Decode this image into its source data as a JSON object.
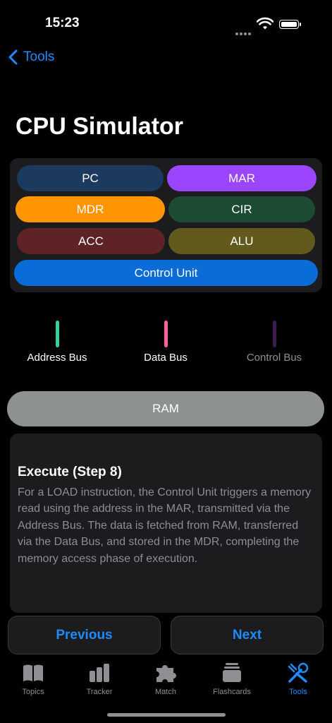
{
  "status_bar": {
    "time": "15:23"
  },
  "nav": {
    "back_label": "Tools"
  },
  "page": {
    "title": "CPU Simulator"
  },
  "registers": [
    {
      "label": "PC",
      "color": "#1b3a5e"
    },
    {
      "label": "MAR",
      "color": "#9b45ff"
    },
    {
      "label": "MDR",
      "color": "#ff9500"
    },
    {
      "label": "CIR",
      "color": "#1c4a33"
    },
    {
      "label": "ACC",
      "color": "#5e2227"
    },
    {
      "label": "ALU",
      "color": "#625a1c"
    },
    {
      "label": "Control Unit",
      "color": "#0a6cd6"
    }
  ],
  "buses": [
    {
      "label": "Address Bus",
      "color": "#34d399",
      "active": true
    },
    {
      "label": "Data Bus",
      "color": "#ff5fa2",
      "active": true
    },
    {
      "label": "Control Bus",
      "color": "#3b1d4f",
      "active": false
    }
  ],
  "ram": {
    "label": "RAM",
    "color": "#8e9191"
  },
  "explanation": {
    "title": "Execute (Step 8)",
    "body": "For a LOAD instruction, the Control Unit triggers a memory read using the address in the MAR, transmitted via the Address Bus. The data is fetched from RAM, transferred via the Data Bus, and stored in the MDR, completing the memory access phase of execution."
  },
  "buttons": {
    "previous": "Previous",
    "next": "Next"
  },
  "tabs": [
    {
      "label": "Topics",
      "icon": "book-icon",
      "active": false
    },
    {
      "label": "Tracker",
      "icon": "bar-chart-icon",
      "active": false
    },
    {
      "label": "Match",
      "icon": "puzzle-icon",
      "active": false
    },
    {
      "label": "Flashcards",
      "icon": "cards-stack-icon",
      "active": false
    },
    {
      "label": "Tools",
      "icon": "tools-icon",
      "active": true
    }
  ],
  "accent_color": "#1e8bff"
}
